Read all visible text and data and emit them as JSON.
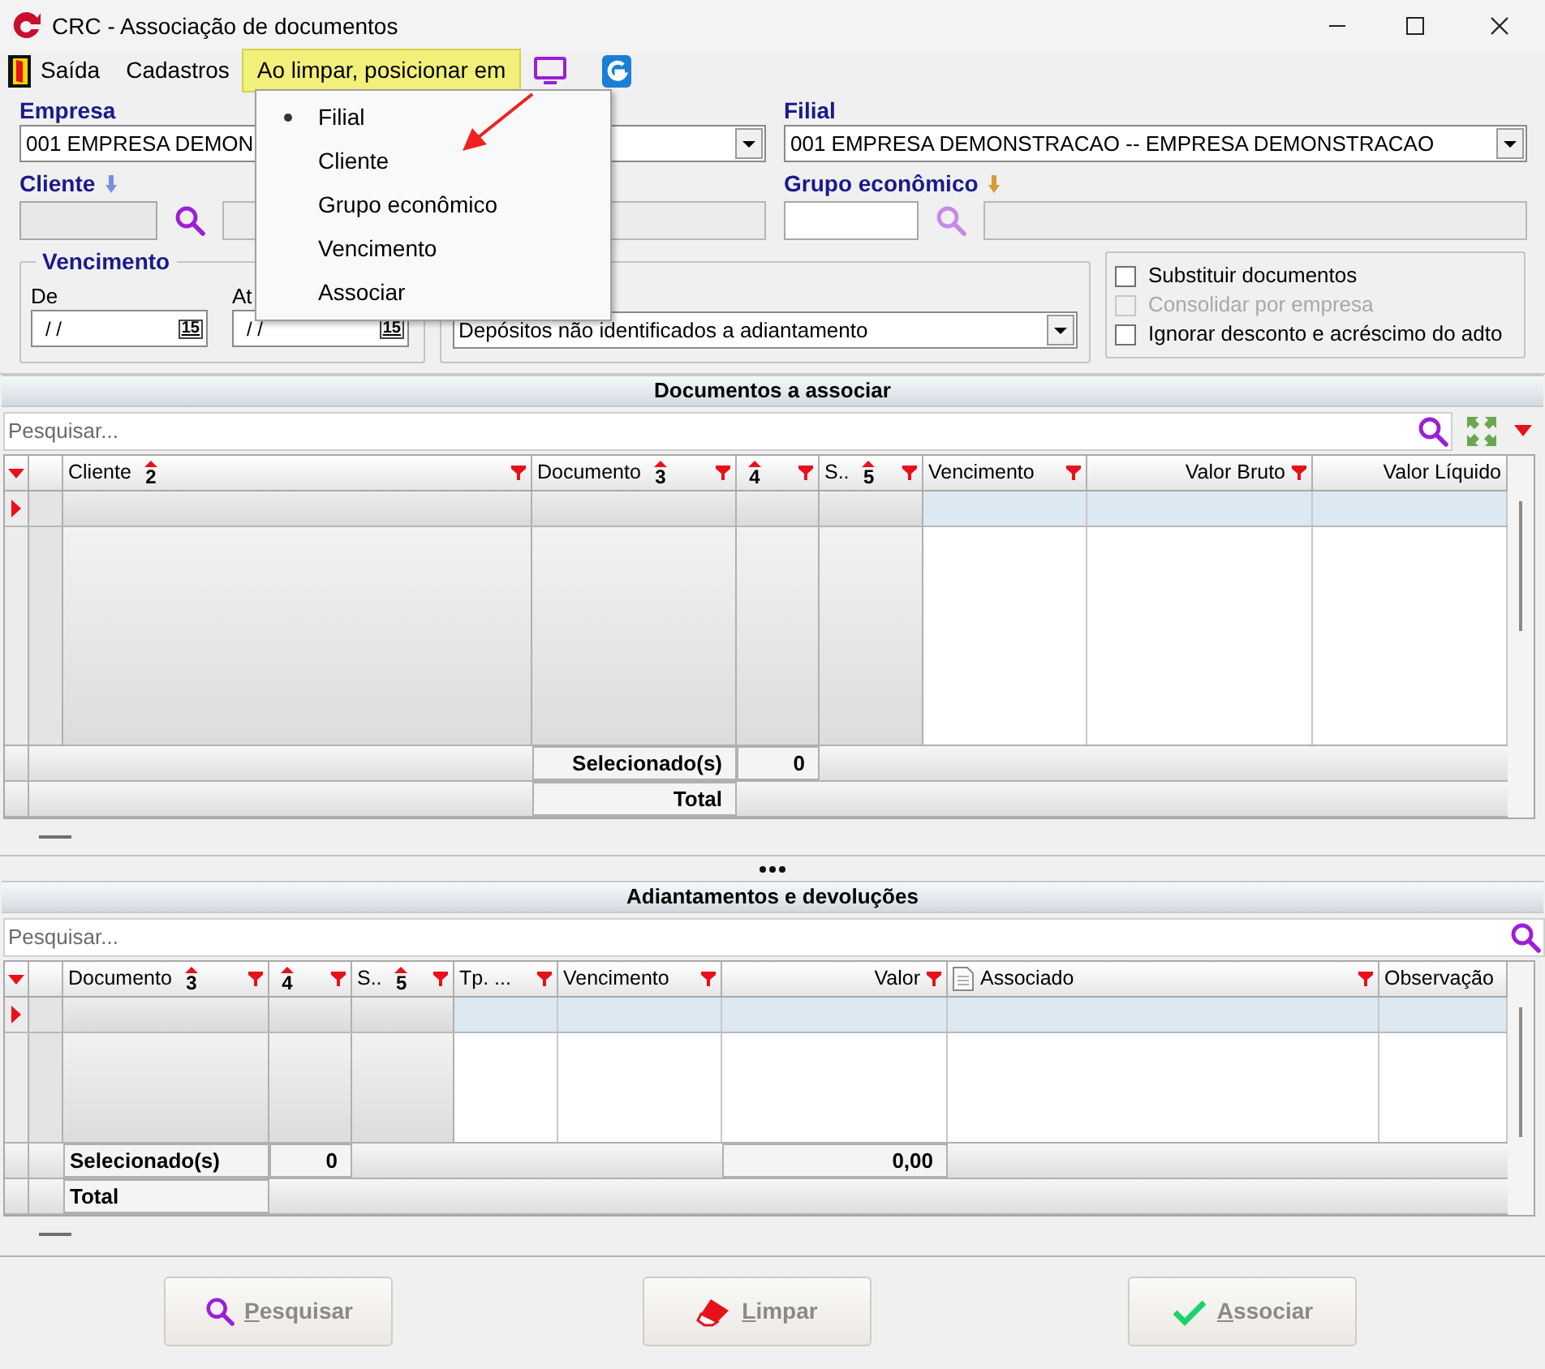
{
  "window": {
    "title": "CRC - Associação de documentos"
  },
  "menubar": [
    {
      "label": "Saída",
      "kind": "exit",
      "open": false
    },
    {
      "label": "Cadastros",
      "kind": "plain",
      "open": false
    },
    {
      "label": "Ao limpar, posicionar em",
      "kind": "plain",
      "open": true
    }
  ],
  "dropdown": [
    {
      "label": "Filial",
      "selected": true
    },
    {
      "label": "Cliente",
      "selected": false
    },
    {
      "label": "Grupo econômico",
      "selected": false
    },
    {
      "label": "Vencimento",
      "selected": false
    },
    {
      "label": "Associar",
      "selected": false
    }
  ],
  "form": {
    "empresa": {
      "label": "Empresa",
      "value": "001 EMPRESA DEMON"
    },
    "filial": {
      "label": "Filial",
      "value": "001 EMPRESA DEMONSTRACAO -- EMPRESA DEMONSTRACAO"
    },
    "cliente": {
      "label": "Cliente"
    },
    "grupo": {
      "label": "Grupo econômico"
    },
    "vencimento": {
      "label": "Vencimento",
      "from_label": "De",
      "to_label": "At",
      "from_value": "/ /",
      "to_value": "/ /",
      "from_calendar": "15",
      "to_calendar": "15"
    },
    "tipo": {
      "value": "Depósitos não identificados a adiantamento"
    },
    "checkboxes": [
      {
        "label": "Substituir documentos",
        "checked": false,
        "disabled": false
      },
      {
        "label": "Consolidar por empresa",
        "checked": false,
        "disabled": true
      },
      {
        "label": "Ignorar desconto e acréscimo do adto",
        "checked": false,
        "disabled": false
      }
    ]
  },
  "grids": [
    {
      "title": "Documentos a associar",
      "placeholder": "Pesquisar...",
      "tools": true,
      "columns": [
        {
          "label": "Cliente",
          "sort": "2",
          "filter": true,
          "frozen": true,
          "kind": "text"
        },
        {
          "label": "Documento",
          "sort": "3",
          "filter": true,
          "frozen": true,
          "kind": "text",
          "selected_footer": "Selecionado(s)",
          "total_footer": "Total"
        },
        {
          "sort": "4",
          "filter": true,
          "frozen": true,
          "kind": "text",
          "selected_footer": "0"
        },
        {
          "label": "S..",
          "sort": "5",
          "filter": true,
          "frozen": true,
          "kind": "text"
        },
        {
          "label": "Vencimento",
          "filter": true,
          "frozen": false,
          "kind": "text"
        },
        {
          "label": "Valor Bruto",
          "filter": true,
          "frozen": false,
          "kind": "number"
        },
        {
          "label": "Valor Líquido",
          "filter": false,
          "frozen": false,
          "kind": "number"
        }
      ]
    },
    {
      "title": "Adiantamentos e devoluções",
      "placeholder": "Pesquisar...",
      "tools": false,
      "columns": [
        {
          "label": "Documento",
          "sort": "3",
          "filter": true,
          "frozen": true,
          "kind": "text",
          "selected_footer": "Selecionado(s)",
          "total_footer": "Total"
        },
        {
          "sort": "4",
          "filter": true,
          "frozen": true,
          "kind": "text",
          "selected_footer": "0"
        },
        {
          "label": "S..",
          "sort": "5",
          "filter": true,
          "frozen": true,
          "kind": "text"
        },
        {
          "label": "Tp. ...",
          "filter": true,
          "frozen": false,
          "kind": "text"
        },
        {
          "label": "Vencimento",
          "filter": true,
          "frozen": false,
          "kind": "text"
        },
        {
          "label": "Valor",
          "filter": true,
          "frozen": false,
          "kind": "number",
          "selected_footer": "0,00"
        },
        {
          "label": "Associado",
          "filter": true,
          "frozen": false,
          "kind": "document"
        },
        {
          "label": "Observação",
          "filter": false,
          "frozen": false,
          "kind": "text"
        }
      ]
    }
  ],
  "buttons": [
    {
      "label": "Pesquisar",
      "kind": "search",
      "disabled": true
    },
    {
      "label": "Limpar",
      "kind": "clear",
      "disabled": true
    },
    {
      "label": "Associar",
      "kind": "confirm",
      "disabled": true
    }
  ]
}
